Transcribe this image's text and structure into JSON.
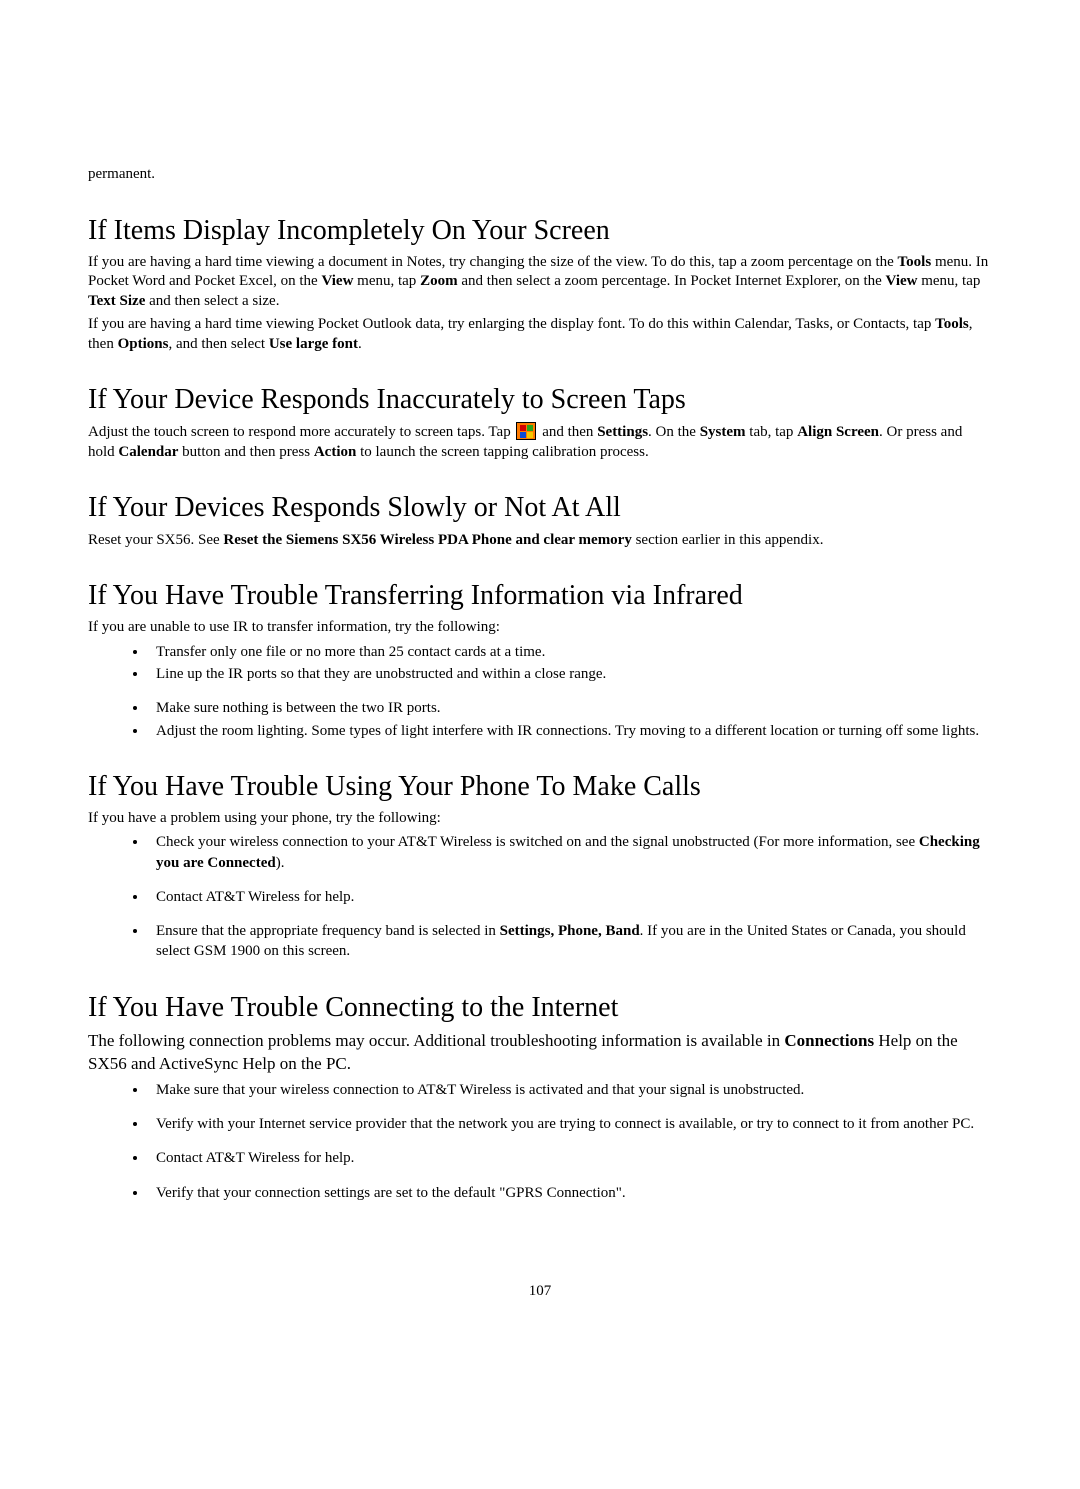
{
  "top_fragment": "permanent.",
  "s1": {
    "heading": "If Items Display Incompletely On Your Screen",
    "p1a": "If you are having a hard time viewing a document in Notes, try changing the size of the view. To do this, tap a zoom percentage on the ",
    "tools": "Tools",
    "p1b": " menu. In Pocket Word and Pocket Excel, on the ",
    "view1": "View",
    "p1c": " menu, tap ",
    "zoom": "Zoom",
    "p1d": " and then select a zoom percentage. In Pocket Internet Explorer, on the ",
    "view2": "View",
    "p1e": " menu, tap ",
    "textsize": "Text Size",
    "p1f": " and then select a size.",
    "p2a": "If you are having a hard time viewing Pocket Outlook data, try enlarging the display font. To do this within Calendar, Tasks, or Contacts, tap ",
    "tools2": "Tools",
    "p2b": ", then ",
    "options": "Options",
    "p2c": ", and then select ",
    "uselarge": "Use large font",
    "p2d": "."
  },
  "s2": {
    "heading": "If Your Device Responds Inaccurately to Screen Taps",
    "p1a": "Adjust the touch screen to respond more accurately to screen taps. Tap ",
    "p1b": " and then ",
    "settings": "Settings",
    "p1c": ". On the ",
    "system": "System",
    "p1d": " tab, tap ",
    "align": "Align Screen",
    "p1e": ". Or press and hold ",
    "calendar": "Calendar",
    "p1f": " button and then press ",
    "action": "Action",
    "p1g": " to launch the screen tapping calibration process."
  },
  "s3": {
    "heading": "If Your Devices Responds Slowly or Not At All",
    "p1a": "Reset your SX56. See ",
    "reset": "Reset the Siemens SX56 Wireless PDA Phone and clear memory",
    "p1b": " section earlier in this appendix."
  },
  "s4": {
    "heading": "If You Have Trouble Transferring Information via Infrared",
    "intro": "If you are unable to use IR to transfer information, try the following:",
    "li1": "Transfer only one file or no more than 25 contact cards at a time.",
    "li2": "Line up the IR ports so that they are unobstructed and within a close range.",
    "li3": "Make sure nothing is between the two IR ports.",
    "li4": "Adjust the room lighting. Some types of light interfere with IR connections. Try moving to a different location or turning off some lights."
  },
  "s5": {
    "heading": "If You Have Trouble Using Your Phone To Make Calls",
    "intro": "If you have a problem using your phone, try the following:",
    "li1a": "Check your wireless connection to your AT&T Wireless is switched on and the signal unobstructed (For more information, see ",
    "li1bold": "Checking you are Connected",
    "li1b": ").",
    "li2": "Contact AT&T Wireless for help.",
    "li3a": "Ensure that the appropriate frequency band is selected in ",
    "li3bold": "Settings, Phone, Band",
    "li3b": ".  If you are in the United States or Canada, you should select GSM 1900 on this screen."
  },
  "s6": {
    "heading": "If You Have Trouble Connecting to the Internet",
    "intro_a": "The following connection problems may occur. Additional troubleshooting information is available in ",
    "intro_bold": "Connections",
    "intro_b": " Help on the SX56 and ActiveSync Help on the PC.",
    "li1": "Make sure that your wireless connection to AT&T Wireless is activated and that your signal is unobstructed.",
    "li2": "Verify with your Internet service provider that the network you are trying to connect is available, or try to connect to it from another PC.",
    "li3": "Contact AT&T Wireless for help.",
    "li4": "Verify that your connection settings are set to the default \"GPRS Connection\"."
  },
  "page_number": "107"
}
